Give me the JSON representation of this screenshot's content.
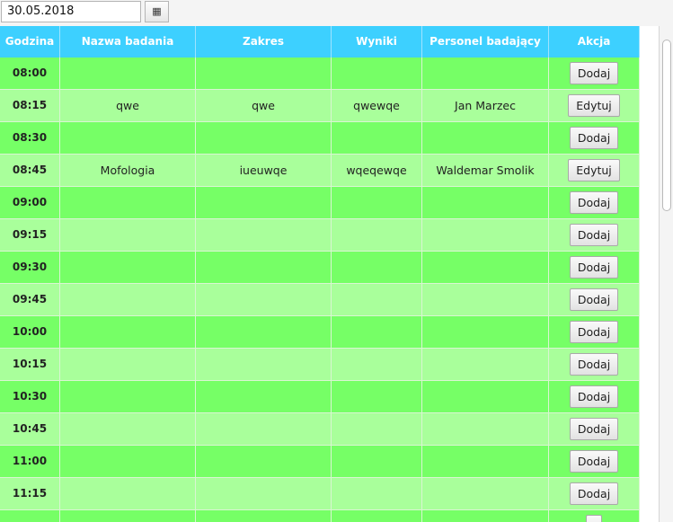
{
  "date_picker": {
    "value": "30.05.2018",
    "calendar_icon": "calendar-icon",
    "calendar_glyph": "▦"
  },
  "table": {
    "columns": [
      "Godzina",
      "Nazwa badania",
      "Zakres",
      "Wyniki",
      "Personel badający",
      "Akcja"
    ],
    "rows": [
      {
        "time": "08:00",
        "name": "",
        "range": "",
        "results": "",
        "staff": "",
        "action": "Dodaj"
      },
      {
        "time": "08:15",
        "name": "qwe",
        "range": "qwe",
        "results": "qwewqe",
        "staff": "Jan Marzec",
        "action": "Edytuj"
      },
      {
        "time": "08:30",
        "name": "",
        "range": "",
        "results": "",
        "staff": "",
        "action": "Dodaj"
      },
      {
        "time": "08:45",
        "name": "Mofologia",
        "range": "iueuwqe",
        "results": "wqeqewqe",
        "staff": "Waldemar Smolik",
        "action": "Edytuj"
      },
      {
        "time": "09:00",
        "name": "",
        "range": "",
        "results": "",
        "staff": "",
        "action": "Dodaj"
      },
      {
        "time": "09:15",
        "name": "",
        "range": "",
        "results": "",
        "staff": "",
        "action": "Dodaj"
      },
      {
        "time": "09:30",
        "name": "",
        "range": "",
        "results": "",
        "staff": "",
        "action": "Dodaj"
      },
      {
        "time": "09:45",
        "name": "",
        "range": "",
        "results": "",
        "staff": "",
        "action": "Dodaj"
      },
      {
        "time": "10:00",
        "name": "",
        "range": "",
        "results": "",
        "staff": "",
        "action": "Dodaj"
      },
      {
        "time": "10:15",
        "name": "",
        "range": "",
        "results": "",
        "staff": "",
        "action": "Dodaj"
      },
      {
        "time": "10:30",
        "name": "",
        "range": "",
        "results": "",
        "staff": "",
        "action": "Dodaj"
      },
      {
        "time": "10:45",
        "name": "",
        "range": "",
        "results": "",
        "staff": "",
        "action": "Dodaj"
      },
      {
        "time": "11:00",
        "name": "",
        "range": "",
        "results": "",
        "staff": "",
        "action": "Dodaj"
      },
      {
        "time": "11:15",
        "name": "",
        "range": "",
        "results": "",
        "staff": "",
        "action": "Dodaj"
      },
      {
        "time": "",
        "name": "",
        "range": "",
        "results": "",
        "staff": "",
        "action": ""
      }
    ]
  },
  "colors": {
    "header": "#3dd0ff",
    "row_dark": "#76ff66",
    "row_light": "#a9ff9b"
  }
}
